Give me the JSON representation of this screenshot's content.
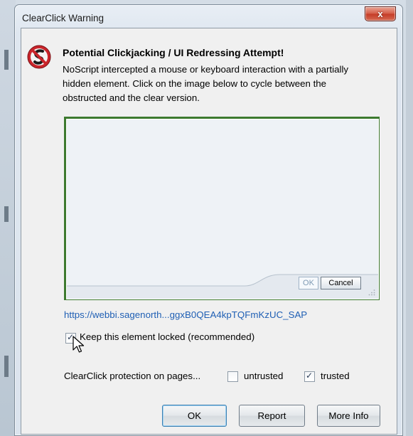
{
  "dialog": {
    "title": "ClearClick Warning",
    "close_label": "x",
    "heading": "Potential Clickjacking / UI Redressing Attempt!",
    "description": "NoScript intercepted a mouse or keyboard interaction with a partially hidden element. Click on the image below to cycle between the obstructed and the clear version.",
    "preview": {
      "ok_label": "OK",
      "cancel_label": "Cancel"
    },
    "url": "https://webbi.sagenorth...ggxB0QEA4kpTQFmKzUC_SAP",
    "keep_locked": {
      "label": "Keep this element locked (recommended)",
      "checked": true
    },
    "protection": {
      "label": "ClearClick protection on pages...",
      "untrusted_label": "untrusted",
      "untrusted_checked": false,
      "trusted_label": "trusted",
      "trusted_checked": true
    },
    "buttons": {
      "ok": "OK",
      "report": "Report",
      "more_info": "More Info"
    }
  },
  "colors": {
    "preview_border": "#3d7a2f",
    "link": "#1f5fb4",
    "close_button": "#c43b26"
  },
  "icons": [
    "noscript-logo-icon",
    "close-icon",
    "resize-grip-icon",
    "mouse-cursor-icon",
    "checkmark-icon"
  ]
}
